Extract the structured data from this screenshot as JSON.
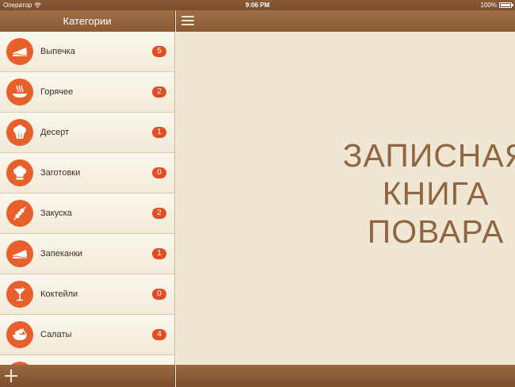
{
  "status_bar": {
    "carrier": "Оператор",
    "time": "9:06 PM",
    "battery": "100%"
  },
  "sidebar": {
    "title": "Категории",
    "items": [
      {
        "label": "Выпечка",
        "count": "5",
        "icon": "cake-slice-icon"
      },
      {
        "label": "Горячее",
        "count": "2",
        "icon": "hot-dish-icon"
      },
      {
        "label": "Десерт",
        "count": "1",
        "icon": "muffin-icon"
      },
      {
        "label": "Заготовки",
        "count": "0",
        "icon": "chef-hat-icon"
      },
      {
        "label": "Закуска",
        "count": "2",
        "icon": "skewer-icon"
      },
      {
        "label": "Запеканки",
        "count": "1",
        "icon": "casserole-slice-icon"
      },
      {
        "label": "Коктейли",
        "count": "0",
        "icon": "cocktail-icon"
      },
      {
        "label": "Салаты",
        "count": "4",
        "icon": "salad-bowl-icon"
      }
    ]
  },
  "main": {
    "title_lines": [
      "ЗАПИСНАЯ",
      "КНИГА",
      "ПОВАРА"
    ]
  },
  "colors": {
    "accent": "#e75f2a",
    "badge": "#e34d24",
    "header": "#8a5a35",
    "title": "#8f6641"
  }
}
